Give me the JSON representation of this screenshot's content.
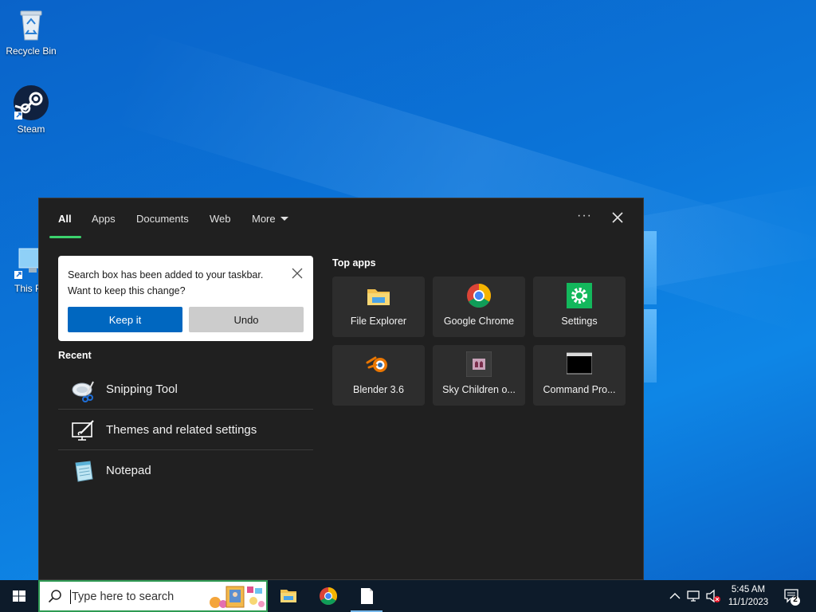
{
  "desktop": {
    "icons": [
      {
        "label": "Recycle Bin",
        "icon": "recycle-bin-icon"
      },
      {
        "label": "Steam",
        "icon": "steam-icon"
      },
      {
        "label": "This P",
        "icon": "this-pc-icon"
      }
    ]
  },
  "search_panel": {
    "tabs": [
      {
        "label": "All",
        "active": true
      },
      {
        "label": "Apps"
      },
      {
        "label": "Documents"
      },
      {
        "label": "Web"
      },
      {
        "label": "More"
      }
    ],
    "options_label": "···",
    "toast": {
      "message_line1": "Search box has been added to your taskbar.",
      "message_line2": "Want to keep this change?",
      "keep_label": "Keep it",
      "undo_label": "Undo"
    },
    "recent": {
      "title": "Recent",
      "items": [
        {
          "label": "Snipping Tool",
          "icon": "snipping-tool-icon"
        },
        {
          "label": "Themes and related settings",
          "icon": "themes-settings-icon"
        },
        {
          "label": "Notepad",
          "icon": "notepad-icon"
        }
      ]
    },
    "top_apps": {
      "title": "Top apps",
      "items": [
        {
          "label": "File Explorer",
          "icon": "file-explorer-icon"
        },
        {
          "label": "Google Chrome",
          "icon": "chrome-icon"
        },
        {
          "label": "Settings",
          "icon": "settings-gear-icon"
        },
        {
          "label": "Blender 3.6",
          "icon": "blender-icon"
        },
        {
          "label": "Sky Children o...",
          "icon": "sky-children-icon"
        },
        {
          "label": "Command Pro...",
          "icon": "command-prompt-icon"
        }
      ]
    }
  },
  "taskbar": {
    "search_placeholder": "Type here to search",
    "pinned": [
      "file-explorer-icon",
      "chrome-icon",
      "notepad-file-icon"
    ],
    "clock_time": "5:45 AM",
    "clock_date": "11/1/2023",
    "notification_count": "2"
  },
  "colors": {
    "accent_green": "#3cd36d",
    "keep_button": "#0067c0",
    "panel_bg": "#202020",
    "tile_bg": "#2d2d2d"
  }
}
